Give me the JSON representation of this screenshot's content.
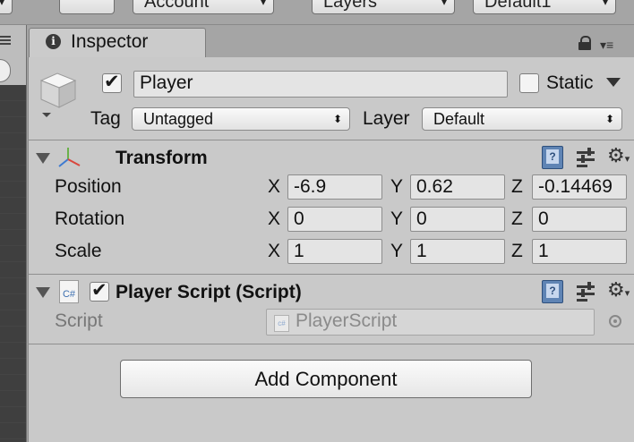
{
  "toolbar": {
    "account_label": "Account",
    "layers_label": "Layers",
    "layout_label": "Default1"
  },
  "tab": {
    "title": "Inspector",
    "info_icon": "info-icon"
  },
  "gameobject": {
    "active": true,
    "name": "Player",
    "static_label": "Static",
    "static": false,
    "tag_label": "Tag",
    "tag_value": "Untagged",
    "layer_label": "Layer",
    "layer_value": "Default"
  },
  "transform": {
    "title": "Transform",
    "position_label": "Position",
    "rotation_label": "Rotation",
    "scale_label": "Scale",
    "axis_x": "X",
    "axis_y": "Y",
    "axis_z": "Z",
    "position": {
      "x": "-6.9",
      "y": "0.62",
      "z": "-0.14469"
    },
    "rotation": {
      "x": "0",
      "y": "0",
      "z": "0"
    },
    "scale": {
      "x": "1",
      "y": "1",
      "z": "1"
    }
  },
  "script_component": {
    "title": "Player Script (Script)",
    "enabled": true,
    "script_label": "Script",
    "script_value": "PlayerScript",
    "cs_icon_text": "C#"
  },
  "add_component_label": "Add Component",
  "colors": {
    "panel": "#c9c9c9",
    "field": "#e4e4e4",
    "help_icon": "#5f84b4"
  }
}
